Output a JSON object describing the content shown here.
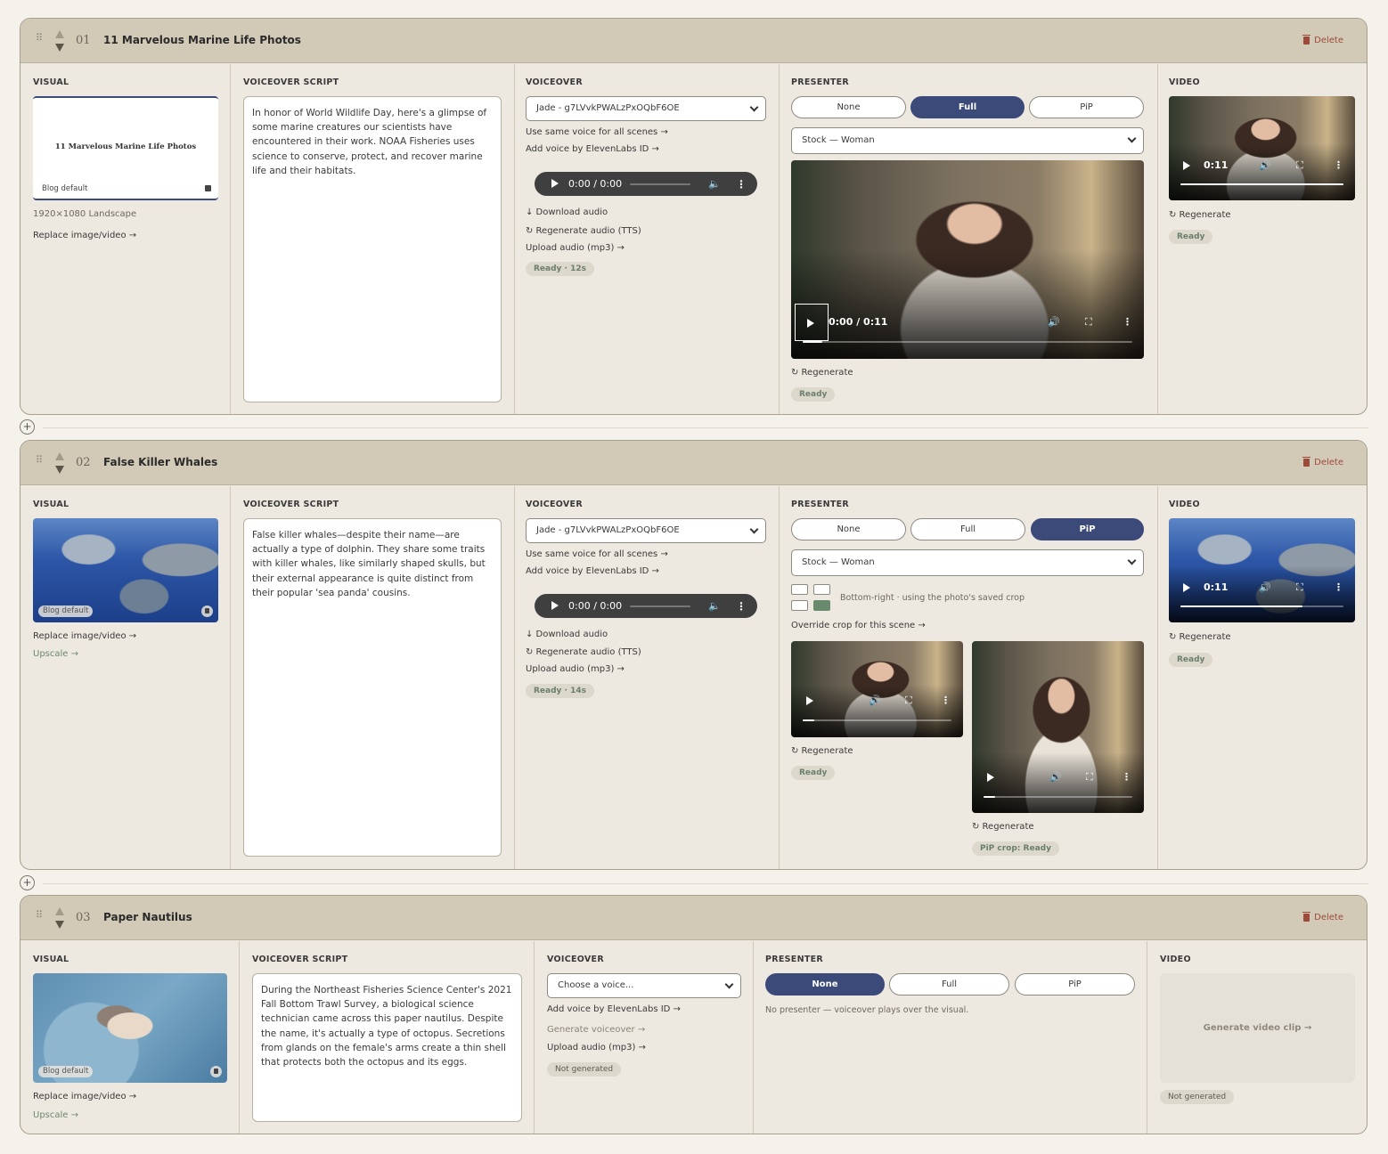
{
  "common": {
    "delete_label": "Delete",
    "visual_label": "VISUAL",
    "script_label": "VOICEOVER SCRIPT",
    "voiceover_label": "VOICEOVER",
    "presenter_label": "PRESENTER",
    "video_label": "VIDEO",
    "replace_link": "Replace image/video →",
    "upscale_link": "Upscale →",
    "same_voice_link": "Use same voice for all scenes →",
    "add_voice_link": "Add voice by ElevenLabs ID →",
    "download_audio": "↓ Download audio",
    "regen_tts": "↻ Regenerate audio (TTS)",
    "upload_audio": "Upload audio (mp3) →",
    "regenerate": "↻ Regenerate",
    "ready": "Ready",
    "blog_default": "Blog default",
    "audio_time": "0:00 / 0:00",
    "presenter_options": [
      "None",
      "Full",
      "PiP"
    ],
    "presenter_select": "Stock — Woman"
  },
  "scenes": [
    {
      "num": "01",
      "title": "11 Marvelous Marine Life Photos",
      "card_title": "11 Marvelous Marine Life Photos",
      "dimensions": "1920×1080  Landscape",
      "script": "In honor of World Wildlife Day, here's a glimpse of some marine creatures our scientists have encountered in their work. NOAA Fisheries uses science to conserve, protect, and recover marine life and their habitats.",
      "voice": "Jade - g7LVvkPWALzPxOQbF6OE",
      "audio_status": "Ready · 12s",
      "presenter_mode": "Full",
      "presenter_video_time": "0:00 / 0:11",
      "presenter_progress": 0.06,
      "video_time": "0:11",
      "video_progress": 1.0
    },
    {
      "num": "02",
      "title": "False Killer Whales",
      "script": "False killer whales—despite their name—are actually a type of dolphin. They share some traits with killer whales, like similarly shaped skulls, but their external appearance is quite distinct from their popular 'sea panda' cousins.",
      "voice": "Jade - g7LVvkPWALzPxOQbF6OE",
      "audio_status": "Ready · 14s",
      "presenter_mode": "PiP",
      "crop_note": "Bottom-right · using the photo's saved crop",
      "override_crop": "Override crop for this scene →",
      "pip_status": "PiP crop: Ready",
      "video_time": "0:11",
      "video_progress": 0.75
    },
    {
      "num": "03",
      "title": "Paper Nautilus",
      "script": "During the Northeast Fisheries Science Center's 2021 Fall Bottom Trawl Survey, a biological science technician came across this paper nautilus. Despite the name, it's actually a type of octopus. Secretions from glands on the female's arms create a thin shell that protects both the octopus and its eggs.",
      "voice_placeholder": "Choose a voice...",
      "generate_voiceover": "Generate voiceover →",
      "voice_status": "Not generated",
      "presenter_mode": "None",
      "no_presenter_note": "No presenter — voiceover plays over the visual.",
      "generate_clip": "Generate video clip →",
      "video_status": "Not generated"
    }
  ]
}
